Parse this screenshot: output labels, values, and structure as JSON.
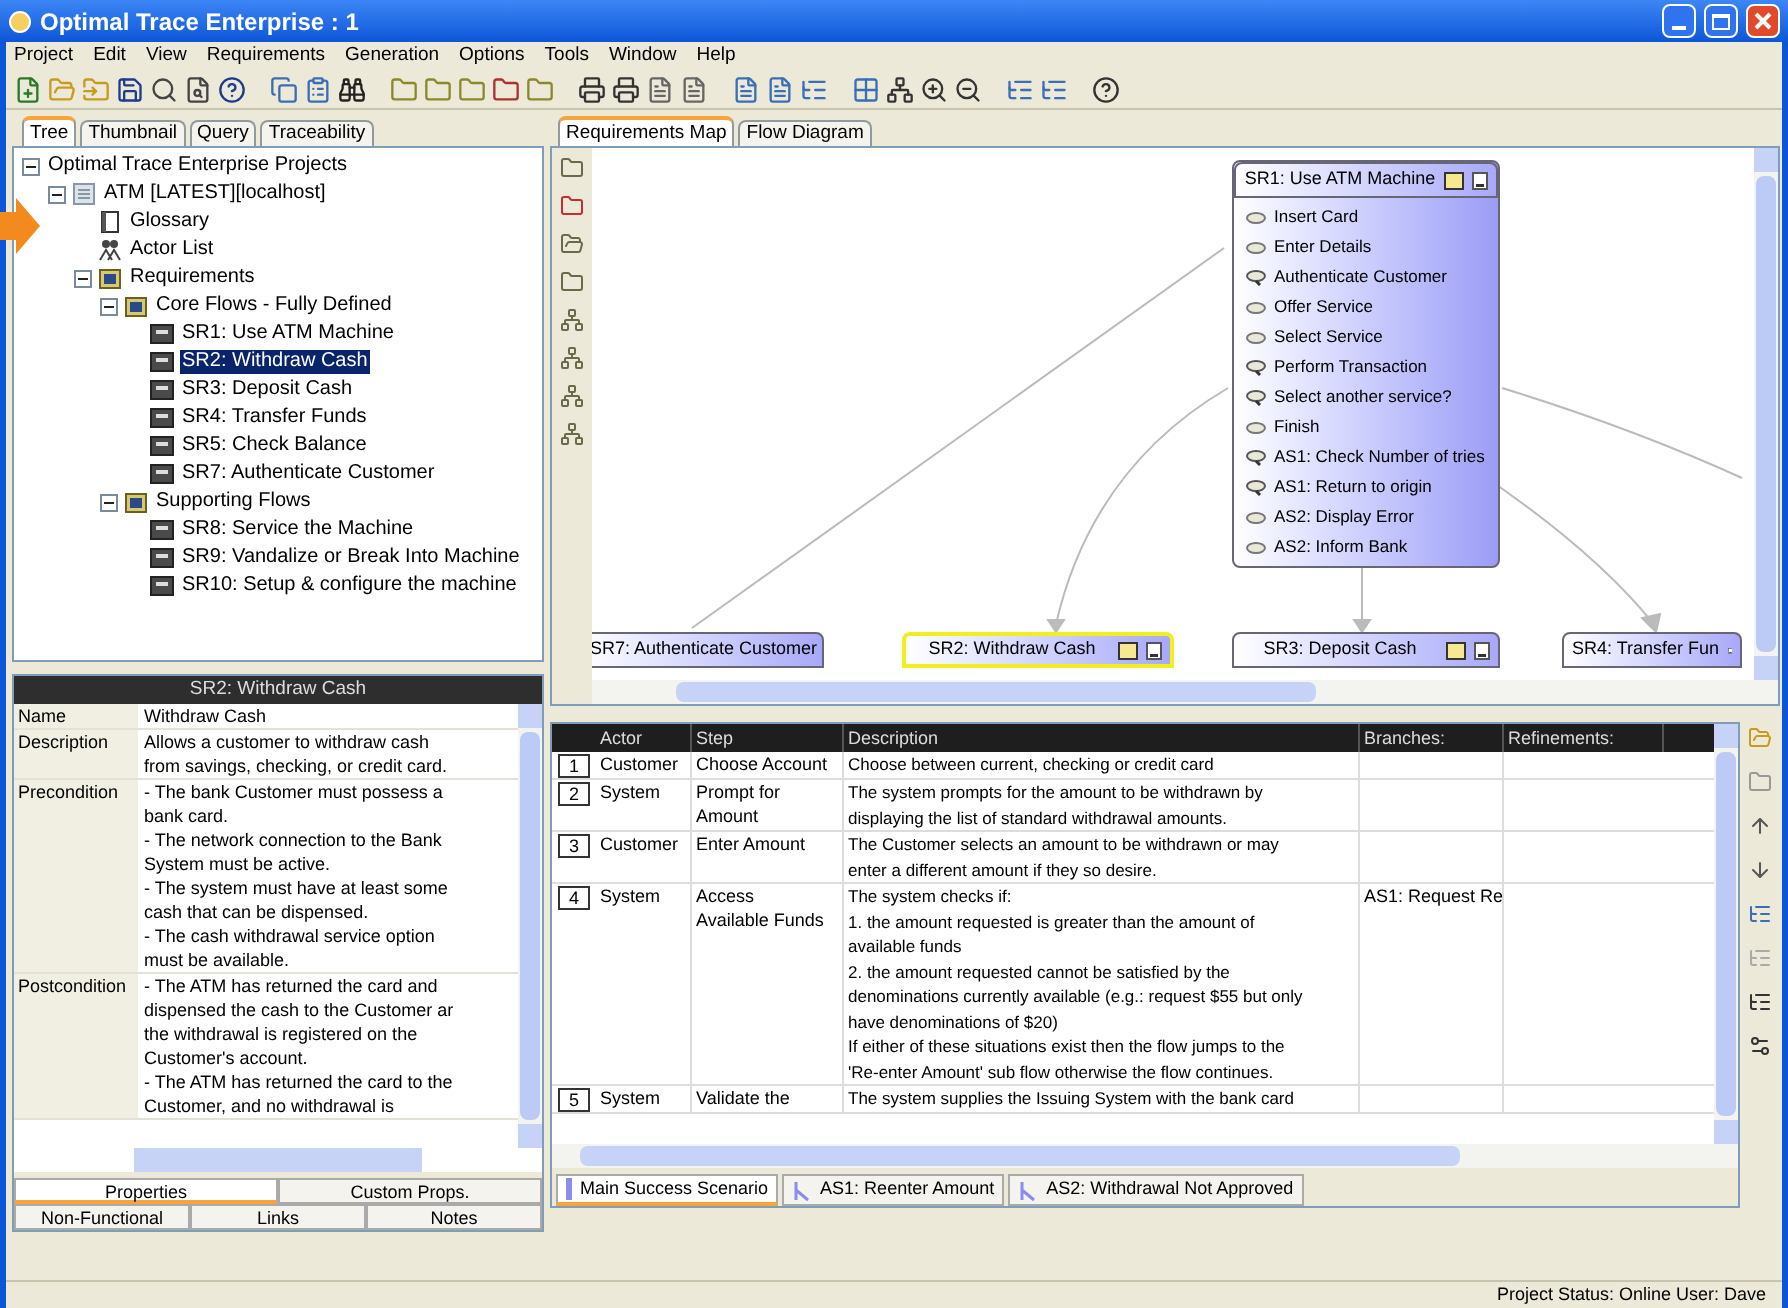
{
  "window": {
    "title": "Optimal Trace Enterprise : 1"
  },
  "menu": [
    "Project",
    "Edit",
    "View",
    "Requirements",
    "Generation",
    "Options",
    "Tools",
    "Window",
    "Help"
  ],
  "left_tabs": [
    {
      "label": "Tree",
      "selected": true
    },
    {
      "label": "Thumbnail",
      "selected": false
    },
    {
      "label": "Query",
      "selected": false
    },
    {
      "label": "Traceability",
      "selected": false
    }
  ],
  "tree": {
    "label": "Optimal Trace Enterprise Projects",
    "expanded": true,
    "children": [
      {
        "label": "ATM [LATEST][localhost]",
        "kind": "project",
        "expanded": true,
        "children": [
          {
            "label": "Glossary",
            "kind": "glossary"
          },
          {
            "label": "Actor List",
            "kind": "actors"
          },
          {
            "label": "Requirements",
            "kind": "folder",
            "expanded": true,
            "children": [
              {
                "label": "Core Flows - Fully Defined",
                "kind": "folder",
                "expanded": true,
                "children": [
                  {
                    "label": "SR1: Use ATM Machine",
                    "kind": "requirement",
                    "selected": false
                  },
                  {
                    "label": "SR2: Withdraw Cash",
                    "kind": "requirement",
                    "selected": true
                  },
                  {
                    "label": "SR3: Deposit Cash",
                    "kind": "requirement",
                    "selected": false
                  },
                  {
                    "label": "SR4: Transfer Funds",
                    "kind": "requirement",
                    "selected": false
                  },
                  {
                    "label": "SR5: Check Balance",
                    "kind": "requirement",
                    "selected": false
                  },
                  {
                    "label": "SR7: Authenticate Customer",
                    "kind": "requirement",
                    "selected": false
                  }
                ]
              },
              {
                "label": "Supporting Flows",
                "kind": "folder",
                "expanded": true,
                "children": [
                  {
                    "label": "SR8: Service the Machine",
                    "kind": "requirement",
                    "selected": false
                  },
                  {
                    "label": "SR9: Vandalize or Break Into Machine",
                    "kind": "requirement",
                    "selected": false
                  },
                  {
                    "label": "SR10: Setup & configure the machine",
                    "kind": "requirement",
                    "selected": false
                  }
                ]
              }
            ]
          }
        ]
      }
    ]
  },
  "properties": {
    "title": "SR2: Withdraw Cash",
    "rows": [
      {
        "name": "Name",
        "lines": [
          "Withdraw Cash"
        ]
      },
      {
        "name": "Description",
        "lines": [
          "Allows a customer to withdraw cash",
          "from savings, checking, or credit card."
        ]
      },
      {
        "name": "Precondition",
        "lines": [
          "- The bank Customer must possess a",
          "bank card.",
          "- The network connection to the Bank",
          "System must be active.",
          "- The system must have at least some",
          "cash that can be dispensed.",
          "- The cash withdrawal service option",
          "must be available."
        ]
      },
      {
        "name": "Postcondition",
        "lines": [
          "- The ATM has returned the card and",
          "dispensed the cash to the Customer ar",
          "the withdrawal is registered on the",
          "Customer's account.",
          "- The ATM has returned the card to the",
          "Customer, and no withdrawal is"
        ]
      }
    ]
  },
  "property_tabs": [
    [
      {
        "label": "Properties",
        "selected": true
      },
      {
        "label": "Custom Props.",
        "selected": false
      }
    ],
    [
      {
        "label": "Non-Functional",
        "selected": false
      },
      {
        "label": "Links",
        "selected": false
      },
      {
        "label": "Notes",
        "selected": false
      }
    ]
  ],
  "map_tabs": [
    {
      "label": "Requirements Map",
      "selected": true
    },
    {
      "label": "Flow Diagram",
      "selected": false
    }
  ],
  "map": {
    "main_node": {
      "title": "SR1: Use ATM Machine",
      "steps": [
        {
          "label": "Insert Card",
          "kind": "step"
        },
        {
          "label": "Enter Details",
          "kind": "step"
        },
        {
          "label": "Authenticate Customer",
          "kind": "include"
        },
        {
          "label": "Offer Service",
          "kind": "step"
        },
        {
          "label": "Select Service",
          "kind": "step"
        },
        {
          "label": "Perform Transaction",
          "kind": "include"
        },
        {
          "label": "Select another service?",
          "kind": "include"
        },
        {
          "label": "Finish",
          "kind": "step"
        },
        {
          "label": "AS1: Check Number of tries",
          "kind": "include"
        },
        {
          "label": "AS1: Return to origin",
          "kind": "include"
        },
        {
          "label": "AS2: Display Error",
          "kind": "step"
        },
        {
          "label": "AS2: Inform Bank",
          "kind": "step"
        }
      ]
    },
    "nodes": [
      {
        "title": "SR7: Authenticate Customer",
        "selected": false
      },
      {
        "title": "SR2: Withdraw Cash",
        "selected": true
      },
      {
        "title": "SR3: Deposit Cash",
        "selected": false
      },
      {
        "title": "SR4: Transfer Fun",
        "selected": false
      }
    ]
  },
  "table": {
    "columns": [
      "Actor",
      "Step",
      "Description",
      "Branches:",
      "Refinements:"
    ],
    "rows": [
      {
        "number": "1",
        "actor": "Customer",
        "step": [
          "Choose Account"
        ],
        "description": [
          "Choose between current, checking or credit card"
        ]
      },
      {
        "number": "2",
        "actor": "System",
        "step": [
          "Prompt for",
          "Amount"
        ],
        "description": [
          "The system prompts for the amount to be withdrawn by",
          "displaying the list of standard withdrawal amounts."
        ]
      },
      {
        "number": "3",
        "actor": "Customer",
        "step": [
          "Enter Amount"
        ],
        "description": [
          "The Customer selects an amount to be withdrawn or may",
          "enter a different amount if they so desire."
        ]
      },
      {
        "number": "4",
        "actor": "System",
        "step": [
          "Access",
          "Available Funds"
        ],
        "description": [
          "The system checks if:",
          "1. the amount requested is greater than the amount of",
          "available funds",
          "2. the amount requested cannot be satisfied by the",
          "denominations currently available (e.g.: request $55 but only",
          "have denominations of $20)",
          "If either of these situations exist then the flow jumps to the",
          "'Re-enter Amount' sub flow otherwise the flow continues."
        ],
        "branches": "AS1: Request Re"
      },
      {
        "number": "5",
        "actor": "System",
        "step": [
          "Validate the"
        ],
        "description": [
          "The system supplies the Issuing System with the bank card"
        ]
      }
    ]
  },
  "scenario_tabs": [
    {
      "label": "Main Success Scenario",
      "kind": "main",
      "selected": true
    },
    {
      "label": "AS1: Reenter Amount",
      "kind": "alternate",
      "selected": false
    },
    {
      "label": "AS2: Withdrawal Not Approved",
      "kind": "alternate",
      "selected": false
    }
  ],
  "status_bar": "Project Status: Online User: Dave"
}
